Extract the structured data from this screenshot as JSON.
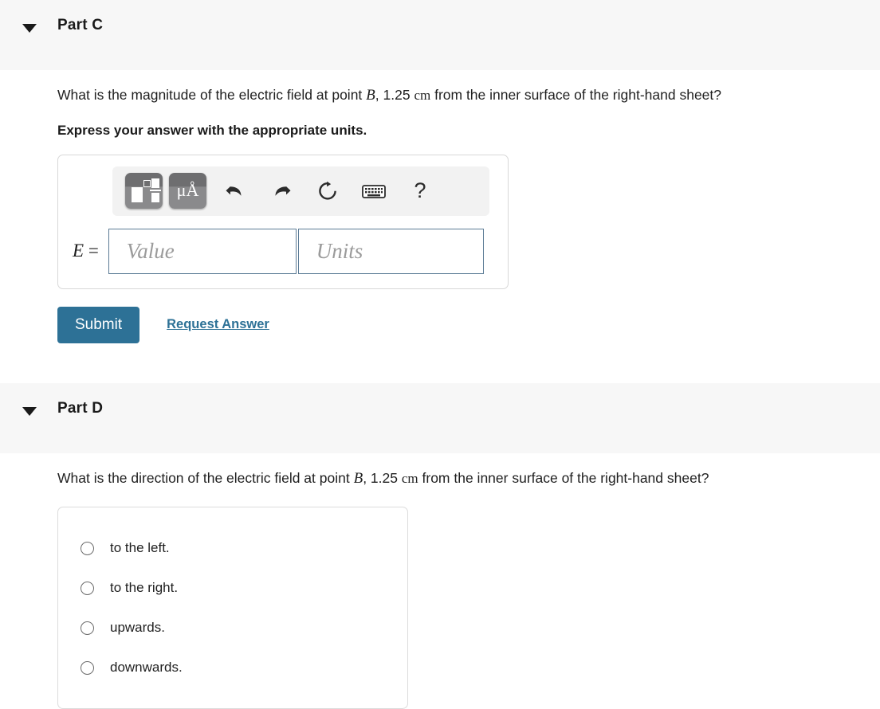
{
  "part_c": {
    "title": "Part C",
    "disclosure_icon": "triangle-down-icon",
    "question": {
      "pre": "What is the magnitude of the electric field at point ",
      "var": "B",
      "mid": ", ",
      "distance": "1.25",
      "unit": "cm",
      "post": " from the inner surface of the right-hand sheet?"
    },
    "instruction": "Express your answer with the appropriate units.",
    "toolbar": {
      "template_button": "math-template-icon",
      "units_button": "μÅ",
      "undo_button": "undo-icon",
      "redo_button": "redo-icon",
      "reset_button": "reset-icon",
      "keyboard_button": "keyboard-icon",
      "help_button": "?"
    },
    "answer": {
      "label_var": "E",
      "label_eq": "=",
      "value_text": "",
      "value_placeholder": "Value",
      "units_text": "",
      "units_placeholder": "Units"
    },
    "submit_label": "Submit",
    "request_answer_label": "Request Answer"
  },
  "part_d": {
    "title": "Part D",
    "disclosure_icon": "triangle-down-icon",
    "question": {
      "pre": "What is the direction of the electric field at point ",
      "var": "B",
      "mid": ", ",
      "distance": "1.25",
      "unit": "cm",
      "post": " from the inner surface of the right-hand sheet?"
    },
    "choices": [
      {
        "label": "to the left.",
        "selected": false
      },
      {
        "label": "to the right.",
        "selected": false
      },
      {
        "label": "upwards.",
        "selected": false
      },
      {
        "label": "downwards.",
        "selected": false
      }
    ]
  },
  "colors": {
    "accent": "#2d7196",
    "header_band": "#f7f7f7",
    "input_border": "#5b7b95",
    "box_border": "#dcdcdc"
  }
}
